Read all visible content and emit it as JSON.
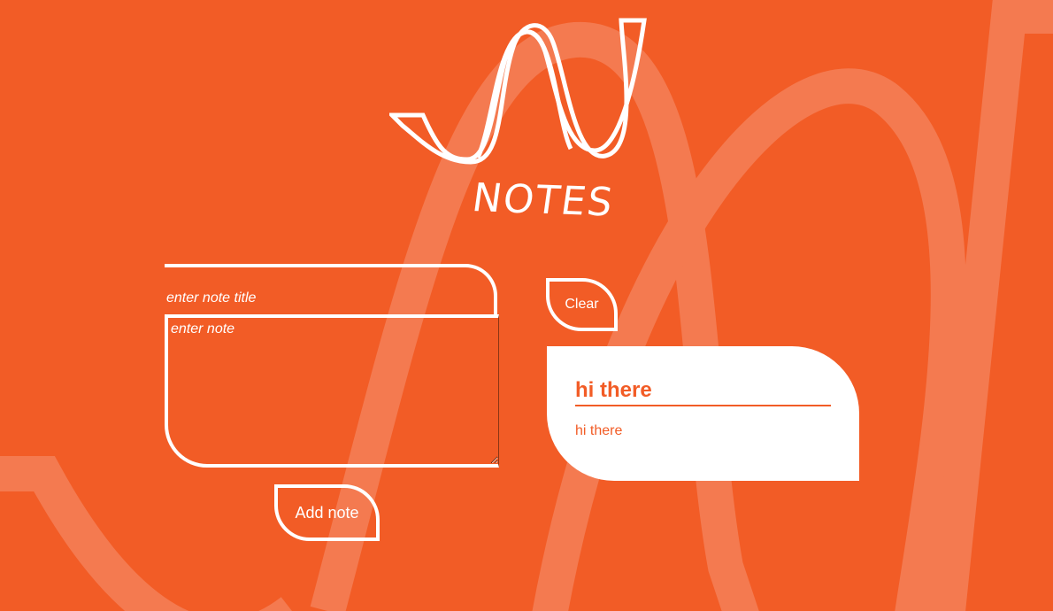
{
  "app": {
    "logo_text": "NOTES",
    "logo_icon": "wave-logo-icon"
  },
  "form": {
    "title_placeholder": "enter note title",
    "title_value": "",
    "body_placeholder": "enter note",
    "body_value": "",
    "add_button_label": "Add note"
  },
  "actions": {
    "clear_button_label": "Clear"
  },
  "notes": [
    {
      "title": "hi there",
      "body": "hi there"
    }
  ],
  "colors": {
    "background": "#f25c26",
    "foreground": "#ffffff",
    "decor": "#f47a50"
  }
}
